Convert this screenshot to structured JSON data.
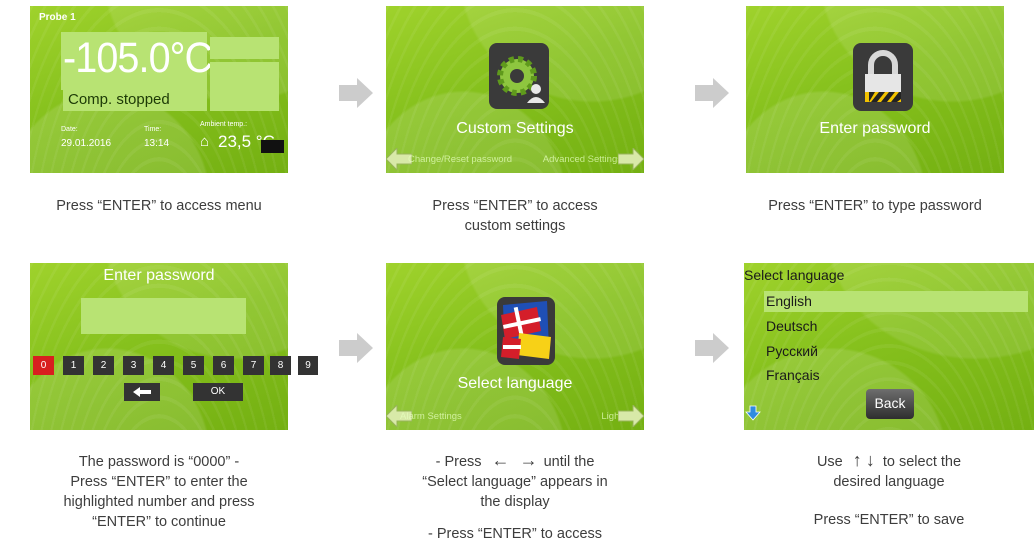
{
  "panel1": {
    "probe": "Probe 1",
    "temperature": "-105.0°C",
    "status": "Comp. stopped",
    "date_label": "Date:",
    "date": "29.01.2016",
    "time_label": "Time:",
    "time": "13:14",
    "ambient_label": "Ambient temp.:",
    "ambient": "23,5 °C",
    "caption": "Press “ENTER” to access menu"
  },
  "panel2": {
    "title": "Custom Settings",
    "nav_left": "Change/Reset password",
    "nav_right": "Advanced Settings",
    "icon": "gear-user-icon",
    "caption_line1": "Press “ENTER” to access",
    "caption_line2": "custom settings"
  },
  "panel3": {
    "title": "Enter password",
    "icon": "padlock-icon",
    "caption": "Press “ENTER” to type password"
  },
  "panel4": {
    "title": "Enter password",
    "keys": [
      "0",
      "1",
      "2",
      "3",
      "4",
      "5",
      "6",
      "7",
      "8",
      "9"
    ],
    "selected_key": "0",
    "ok_label": "OK",
    "caption_line1": "The password is “0000” -",
    "caption_line2": "Press “ENTER” to enter the",
    "caption_line3": "highlighted number and press",
    "caption_line4": "“ENTER” to continue"
  },
  "panel5": {
    "title": "Select language",
    "nav_left": "Alarm Settings",
    "nav_right": "Light",
    "icon": "flags-icon",
    "caption_press": "- Press",
    "caption_until": "until the",
    "caption_line2": "“Select language” appears in",
    "caption_line3": "the display",
    "caption_line4": "- Press “ENTER” to access"
  },
  "panel6": {
    "title": "Select language",
    "languages": [
      "English",
      "Deutsch",
      "Русский",
      "Français"
    ],
    "back_label": "Back",
    "caption_use": "Use",
    "caption_to_select": "to select the",
    "caption_line2": "desired language",
    "caption_line3": "Press “ENTER” to save"
  },
  "colors": {
    "screen_green": "#86c11d",
    "highlight": "#b8e373",
    "arrow_grey": "#cccccc",
    "selected_key": "#d81f1f"
  }
}
